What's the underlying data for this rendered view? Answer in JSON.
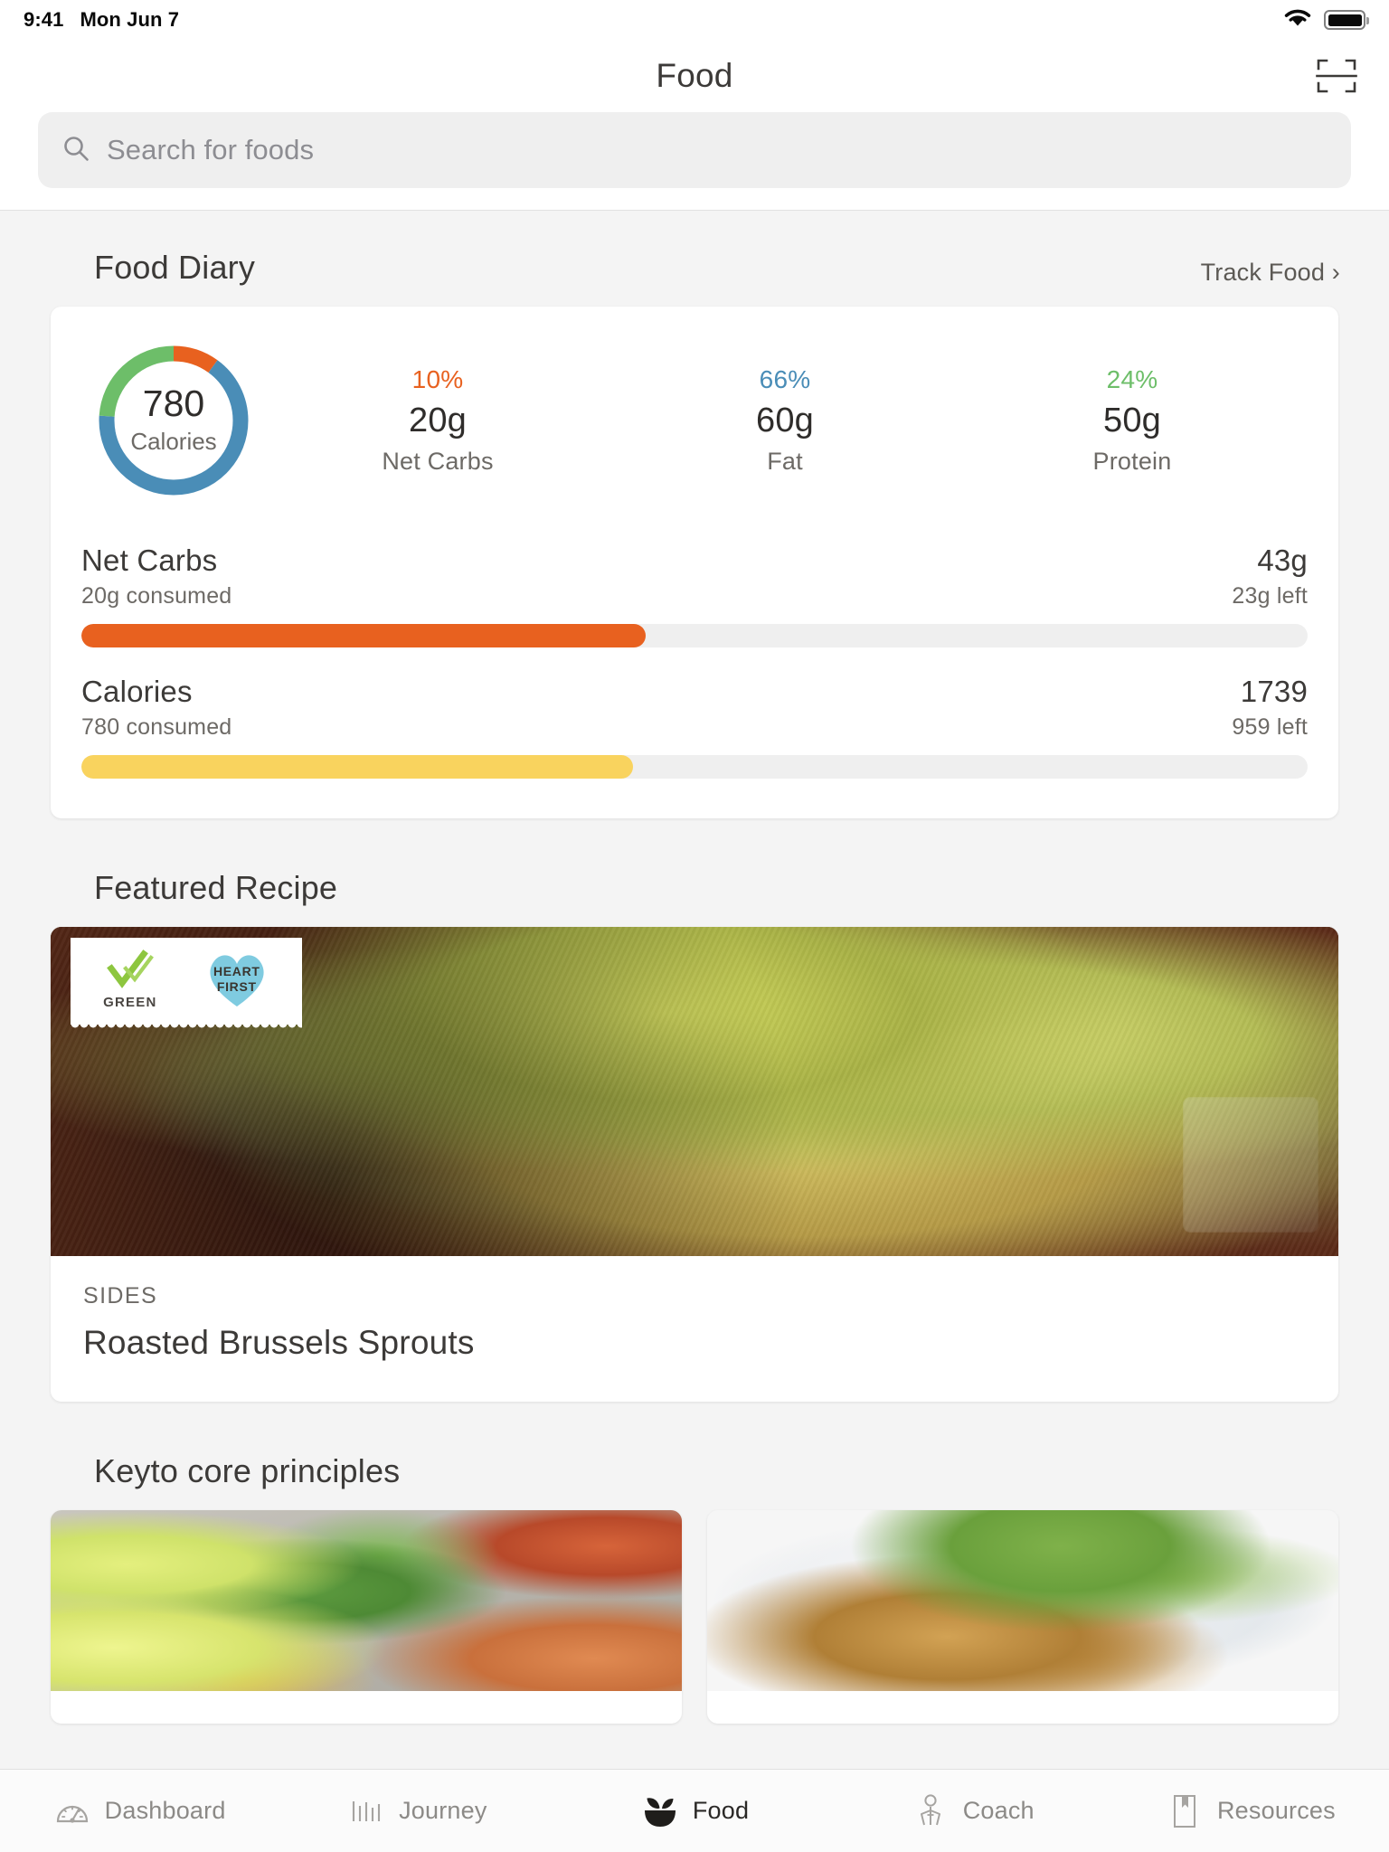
{
  "status_bar": {
    "time": "9:41",
    "date": "Mon Jun 7",
    "wifi_icon": "wifi-icon",
    "battery_icon": "battery-full-icon"
  },
  "navbar": {
    "title": "Food",
    "scan_icon": "barcode-scan-icon"
  },
  "search": {
    "placeholder": "Search for foods",
    "value": "",
    "icon": "search-icon"
  },
  "food_diary": {
    "title": "Food Diary",
    "track_link": "Track Food ›",
    "donut": {
      "calories_value": "780",
      "calories_label": "Calories"
    },
    "macros": [
      {
        "pct": "10%",
        "value": "20g",
        "label": "Net Carbs",
        "color": "#E8611F"
      },
      {
        "pct": "66%",
        "value": "60g",
        "label": "Fat",
        "color": "#4A8DB7"
      },
      {
        "pct": "24%",
        "value": "50g",
        "label": "Protein",
        "color": "#6DBE69"
      }
    ],
    "goals": [
      {
        "name": "Net Carbs",
        "consumed": "20g consumed",
        "target": "43g",
        "left": "23g left",
        "fill_pct": "46%",
        "color": "#E8611F"
      },
      {
        "name": "Calories",
        "consumed": "780 consumed",
        "target": "1739",
        "left": "959 left",
        "fill_pct": "45%",
        "color": "#F9D35E"
      }
    ]
  },
  "featured_recipe": {
    "title": "Featured Recipe",
    "badge": {
      "green_label": "GREEN",
      "heart_line1": "HEART",
      "heart_line2": "FIRST",
      "check_icon": "double-check-icon",
      "heart_icon": "heart-icon",
      "heart_color": "#7FCBE0",
      "check_color": "#8DC63F"
    },
    "kicker": "SIDES",
    "name": "Roasted Brussels Sprouts",
    "photo_alt": "roasted-brussels-sprouts-photo"
  },
  "core_principles": {
    "title": "Keyto core principles",
    "cards": [
      {
        "image_alt": "avocado-broccoli-nuts-photo"
      },
      {
        "image_alt": "salad-with-fish-photo"
      }
    ]
  },
  "chart_data": {
    "type": "pie",
    "title": "Macronutrient breakdown",
    "categories": [
      "Net Carbs",
      "Fat",
      "Protein"
    ],
    "values": [
      10,
      66,
      24
    ],
    "grams": [
      20,
      60,
      50
    ],
    "colors": [
      "#E8611F",
      "#4A8DB7",
      "#6DBE69"
    ],
    "center_value": 780,
    "center_label": "Calories",
    "legend": "right",
    "notes": "Donut chart; orange Net Carbs starts at 12 o'clock clockwise, then blue Fat, then green Protein"
  },
  "tabbar": {
    "items": [
      {
        "label": "Dashboard",
        "icon": "speedometer-icon",
        "active": false
      },
      {
        "label": "Journey",
        "icon": "bar-chart-icon",
        "active": false
      },
      {
        "label": "Food",
        "icon": "food-bowl-icon",
        "active": true
      },
      {
        "label": "Coach",
        "icon": "person-icon",
        "active": false
      },
      {
        "label": "Resources",
        "icon": "bookmark-book-icon",
        "active": false
      }
    ]
  }
}
